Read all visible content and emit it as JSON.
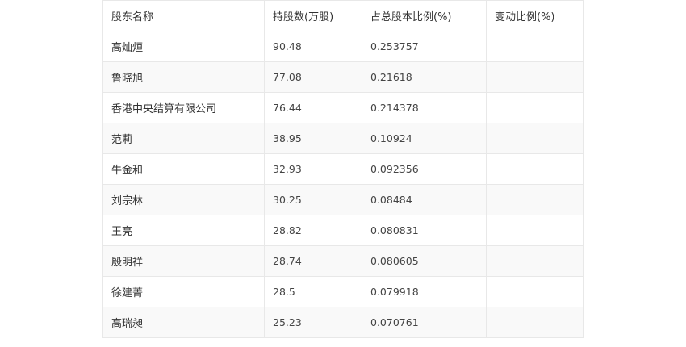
{
  "table": {
    "headers": [
      "股东名称",
      "持股数(万股)",
      "占总股本比例(%)",
      "变动比例(%)"
    ],
    "rows": [
      {
        "name": "高灿烜",
        "shares": "90.48",
        "ratio": "0.253757",
        "change": ""
      },
      {
        "name": "鲁晓旭",
        "shares": "77.08",
        "ratio": "0.21618",
        "change": ""
      },
      {
        "name": "香港中央结算有限公司",
        "shares": "76.44",
        "ratio": "0.214378",
        "change": ""
      },
      {
        "name": "范莉",
        "shares": "38.95",
        "ratio": "0.10924",
        "change": ""
      },
      {
        "name": "牛金和",
        "shares": "32.93",
        "ratio": "0.092356",
        "change": ""
      },
      {
        "name": "刘宗林",
        "shares": "30.25",
        "ratio": "0.08484",
        "change": ""
      },
      {
        "name": "王亮",
        "shares": "28.82",
        "ratio": "0.080831",
        "change": ""
      },
      {
        "name": "殷明祥",
        "shares": "28.74",
        "ratio": "0.080605",
        "change": ""
      },
      {
        "name": "徐建菁",
        "shares": "28.5",
        "ratio": "0.079918",
        "change": ""
      },
      {
        "name": "高瑞昶",
        "shares": "25.23",
        "ratio": "0.070761",
        "change": ""
      }
    ]
  }
}
